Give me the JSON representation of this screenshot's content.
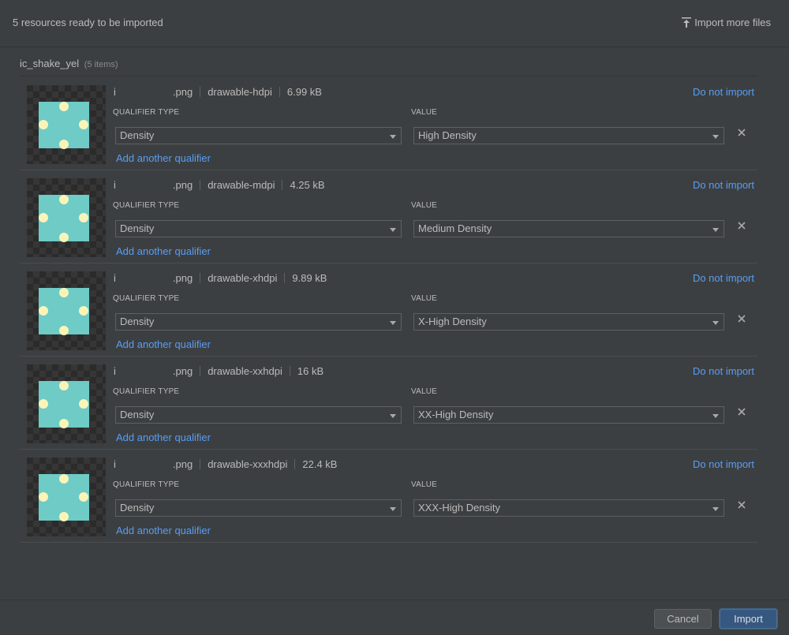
{
  "header": {
    "title": "5 resources ready to be imported",
    "import_more": "Import more files"
  },
  "group": {
    "name": "ic_shake_yel",
    "count": "(5 items)"
  },
  "labels": {
    "qualifier_type": "QUALIFIER TYPE",
    "value": "VALUE",
    "do_not_import": "Do not import",
    "add_qualifier": "Add another qualifier"
  },
  "items": [
    {
      "name": "i",
      "ext": ".png",
      "folder": "drawable-hdpi",
      "size": "6.99 kB",
      "qualifier": "Density",
      "value": "High Density"
    },
    {
      "name": "i",
      "ext": ".png",
      "folder": "drawable-mdpi",
      "size": "4.25 kB",
      "qualifier": "Density",
      "value": "Medium Density"
    },
    {
      "name": "i",
      "ext": ".png",
      "folder": "drawable-xhdpi",
      "size": "9.89 kB",
      "qualifier": "Density",
      "value": "X-High Density"
    },
    {
      "name": "i",
      "ext": ".png",
      "folder": "drawable-xxhdpi",
      "size": "16 kB",
      "qualifier": "Density",
      "value": "XX-High Density"
    },
    {
      "name": "i",
      "ext": ".png",
      "folder": "drawable-xxxhdpi",
      "size": "22.4 kB",
      "qualifier": "Density",
      "value": "XXX-High Density"
    }
  ],
  "footer": {
    "cancel": "Cancel",
    "import": "Import"
  },
  "colors": {
    "background": "#3c3f41",
    "link": "#589df6",
    "preview_fill": "#6ecbc6",
    "preview_dot": "#fbf4b8",
    "primary_button": "#365880"
  }
}
